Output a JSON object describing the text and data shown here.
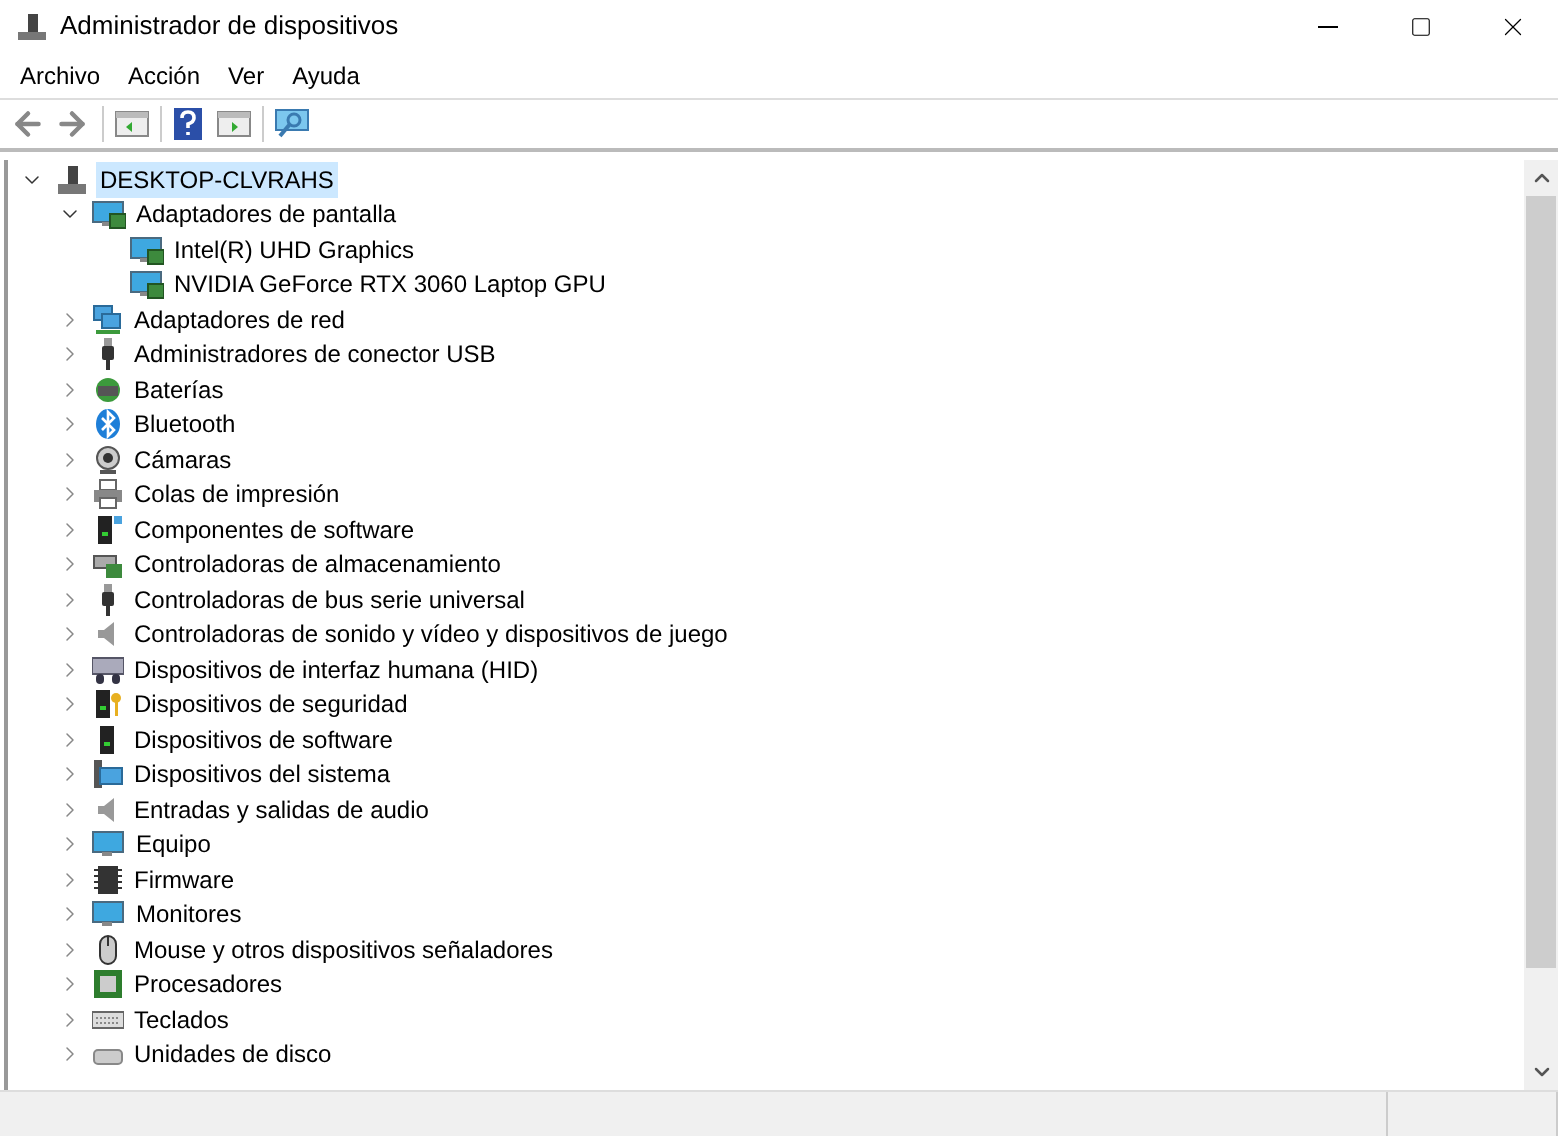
{
  "window": {
    "title": "Administrador de dispositivos"
  },
  "menu": [
    "Archivo",
    "Acción",
    "Ver",
    "Ayuda"
  ],
  "tree": {
    "label": "DESKTOP-CLVRAHS",
    "selected": true,
    "expanded": true,
    "children": [
      {
        "label": "Adaptadores de pantalla",
        "expanded": true,
        "children": [
          {
            "label": "Intel(R) UHD Graphics"
          },
          {
            "label": "NVIDIA GeForce RTX 3060 Laptop GPU"
          }
        ]
      },
      {
        "label": "Adaptadores de red",
        "expanded": false
      },
      {
        "label": "Administradores de conector USB",
        "expanded": false
      },
      {
        "label": "Baterías",
        "expanded": false
      },
      {
        "label": "Bluetooth",
        "expanded": false
      },
      {
        "label": "Cámaras",
        "expanded": false
      },
      {
        "label": "Colas de impresión",
        "expanded": false
      },
      {
        "label": "Componentes de software",
        "expanded": false
      },
      {
        "label": "Controladoras de almacenamiento",
        "expanded": false
      },
      {
        "label": "Controladoras de bus serie universal",
        "expanded": false
      },
      {
        "label": "Controladoras de sonido y vídeo y dispositivos de juego",
        "expanded": false
      },
      {
        "label": "Dispositivos de interfaz humana (HID)",
        "expanded": false
      },
      {
        "label": "Dispositivos de seguridad",
        "expanded": false
      },
      {
        "label": "Dispositivos de software",
        "expanded": false
      },
      {
        "label": "Dispositivos del sistema",
        "expanded": false
      },
      {
        "label": "Entradas y salidas de audio",
        "expanded": false
      },
      {
        "label": "Equipo",
        "expanded": false
      },
      {
        "label": "Firmware",
        "expanded": false
      },
      {
        "label": "Monitores",
        "expanded": false
      },
      {
        "label": "Mouse y otros dispositivos señaladores",
        "expanded": false
      },
      {
        "label": "Procesadores",
        "expanded": false
      },
      {
        "label": "Teclados",
        "expanded": false
      },
      {
        "label": "Unidades de disco",
        "expanded": false
      }
    ]
  }
}
